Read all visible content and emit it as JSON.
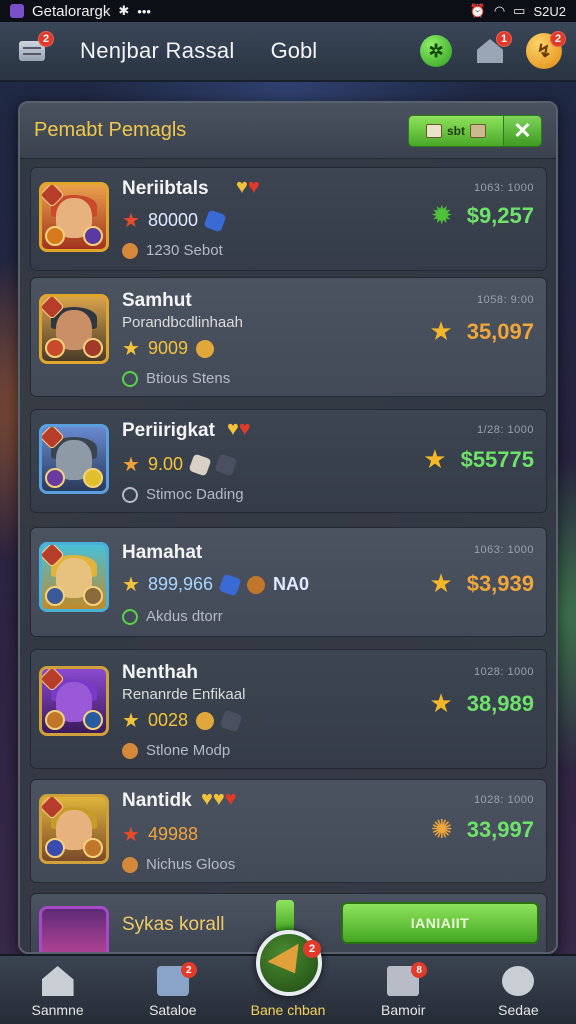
{
  "status_bar": {
    "app_name": "Getalorargk",
    "time_text": "S2U2"
  },
  "header": {
    "title": "Nenjbar Rassal",
    "subtitle": "Gobl",
    "menu_badge": "2",
    "home_badge": "1",
    "coin_badge": "2"
  },
  "panel": {
    "title": "Pemabt Pemagls",
    "filter_label": "sbt",
    "close_label": "✕"
  },
  "rows": [
    {
      "name": "Neriibtals",
      "sub": "",
      "stat": "80000",
      "status": "1230 Sebot",
      "date": "1063: 1000",
      "price": "$9,257",
      "price_color": "#6fe26a",
      "price_icon": "gear"
    },
    {
      "name": "Samhut",
      "sub": "Porandbcdlinhaah",
      "stat": "9009",
      "status": "Btious Stens",
      "date": "1058: 9:00",
      "price": "35,097",
      "price_color": "#f0a63a",
      "price_icon": "star"
    },
    {
      "name": "Periirigkat",
      "sub": "",
      "stat": "9.00",
      "status": "Stimoc Dading",
      "date": "1/28: 1000",
      "price": "$55775",
      "price_color": "#6fe26a",
      "price_icon": "star"
    },
    {
      "name": "Hamahat",
      "sub": "",
      "stat": "899,966",
      "extra": "NA0",
      "status": "Akdus dtorr",
      "date": "1063: 1000",
      "price": "$3,939",
      "price_color": "#f0a63a",
      "price_icon": "star"
    },
    {
      "name": "Nenthah",
      "sub": "Renanrde Enfikaal",
      "stat": "0028",
      "status": "Stlone Modp",
      "date": "1028: 1000",
      "price": "38,989",
      "price_color": "#6fe26a",
      "price_icon": "star"
    },
    {
      "name": "Nantidk",
      "sub": "",
      "stat": "49988",
      "status": "Nichus Gloos",
      "date": "1028: 1000",
      "price": "33,997",
      "price_color": "#6fe26a",
      "price_icon": "sun"
    }
  ],
  "bottom_row": {
    "name": "Sykas korall",
    "button_label": "IANIAIIT"
  },
  "nav": [
    {
      "label": "Sanmne",
      "badge": ""
    },
    {
      "label": "Sataloe",
      "badge": "2"
    },
    {
      "label": "Bane chban",
      "badge": "2"
    },
    {
      "label": "Bamoir",
      "badge": "8"
    },
    {
      "label": "Sedae",
      "badge": ""
    }
  ],
  "colors": {
    "accent_green": "#6fe26a",
    "accent_orange": "#f0a63a",
    "title_gold": "#f1c84a"
  }
}
